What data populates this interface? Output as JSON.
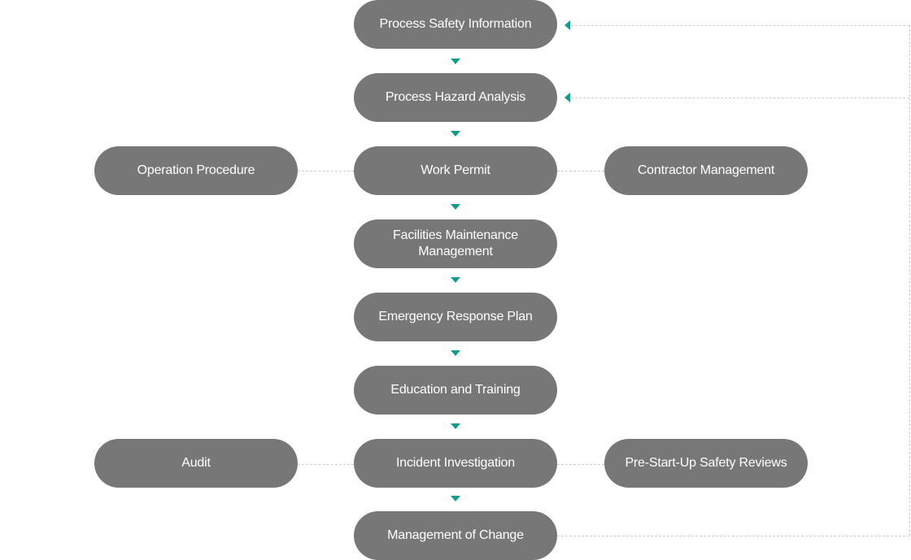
{
  "main_flow": [
    "Process Safety Information",
    "Process Hazard Analysis",
    "Work Permit",
    "Facilities Maintenance Management",
    "Emergency Response Plan",
    "Education and Training",
    "Incident Investigation",
    "Management of Change"
  ],
  "side_nodes": {
    "operation_procedure": "Operation Procedure",
    "contractor_management": "Contractor Management",
    "audit": "Audit",
    "pre_startup": "Pre-Start-Up Safety Reviews"
  },
  "colors": {
    "node": "#777777",
    "arrow": "#159a8c",
    "connector": "#cfcfcf"
  }
}
